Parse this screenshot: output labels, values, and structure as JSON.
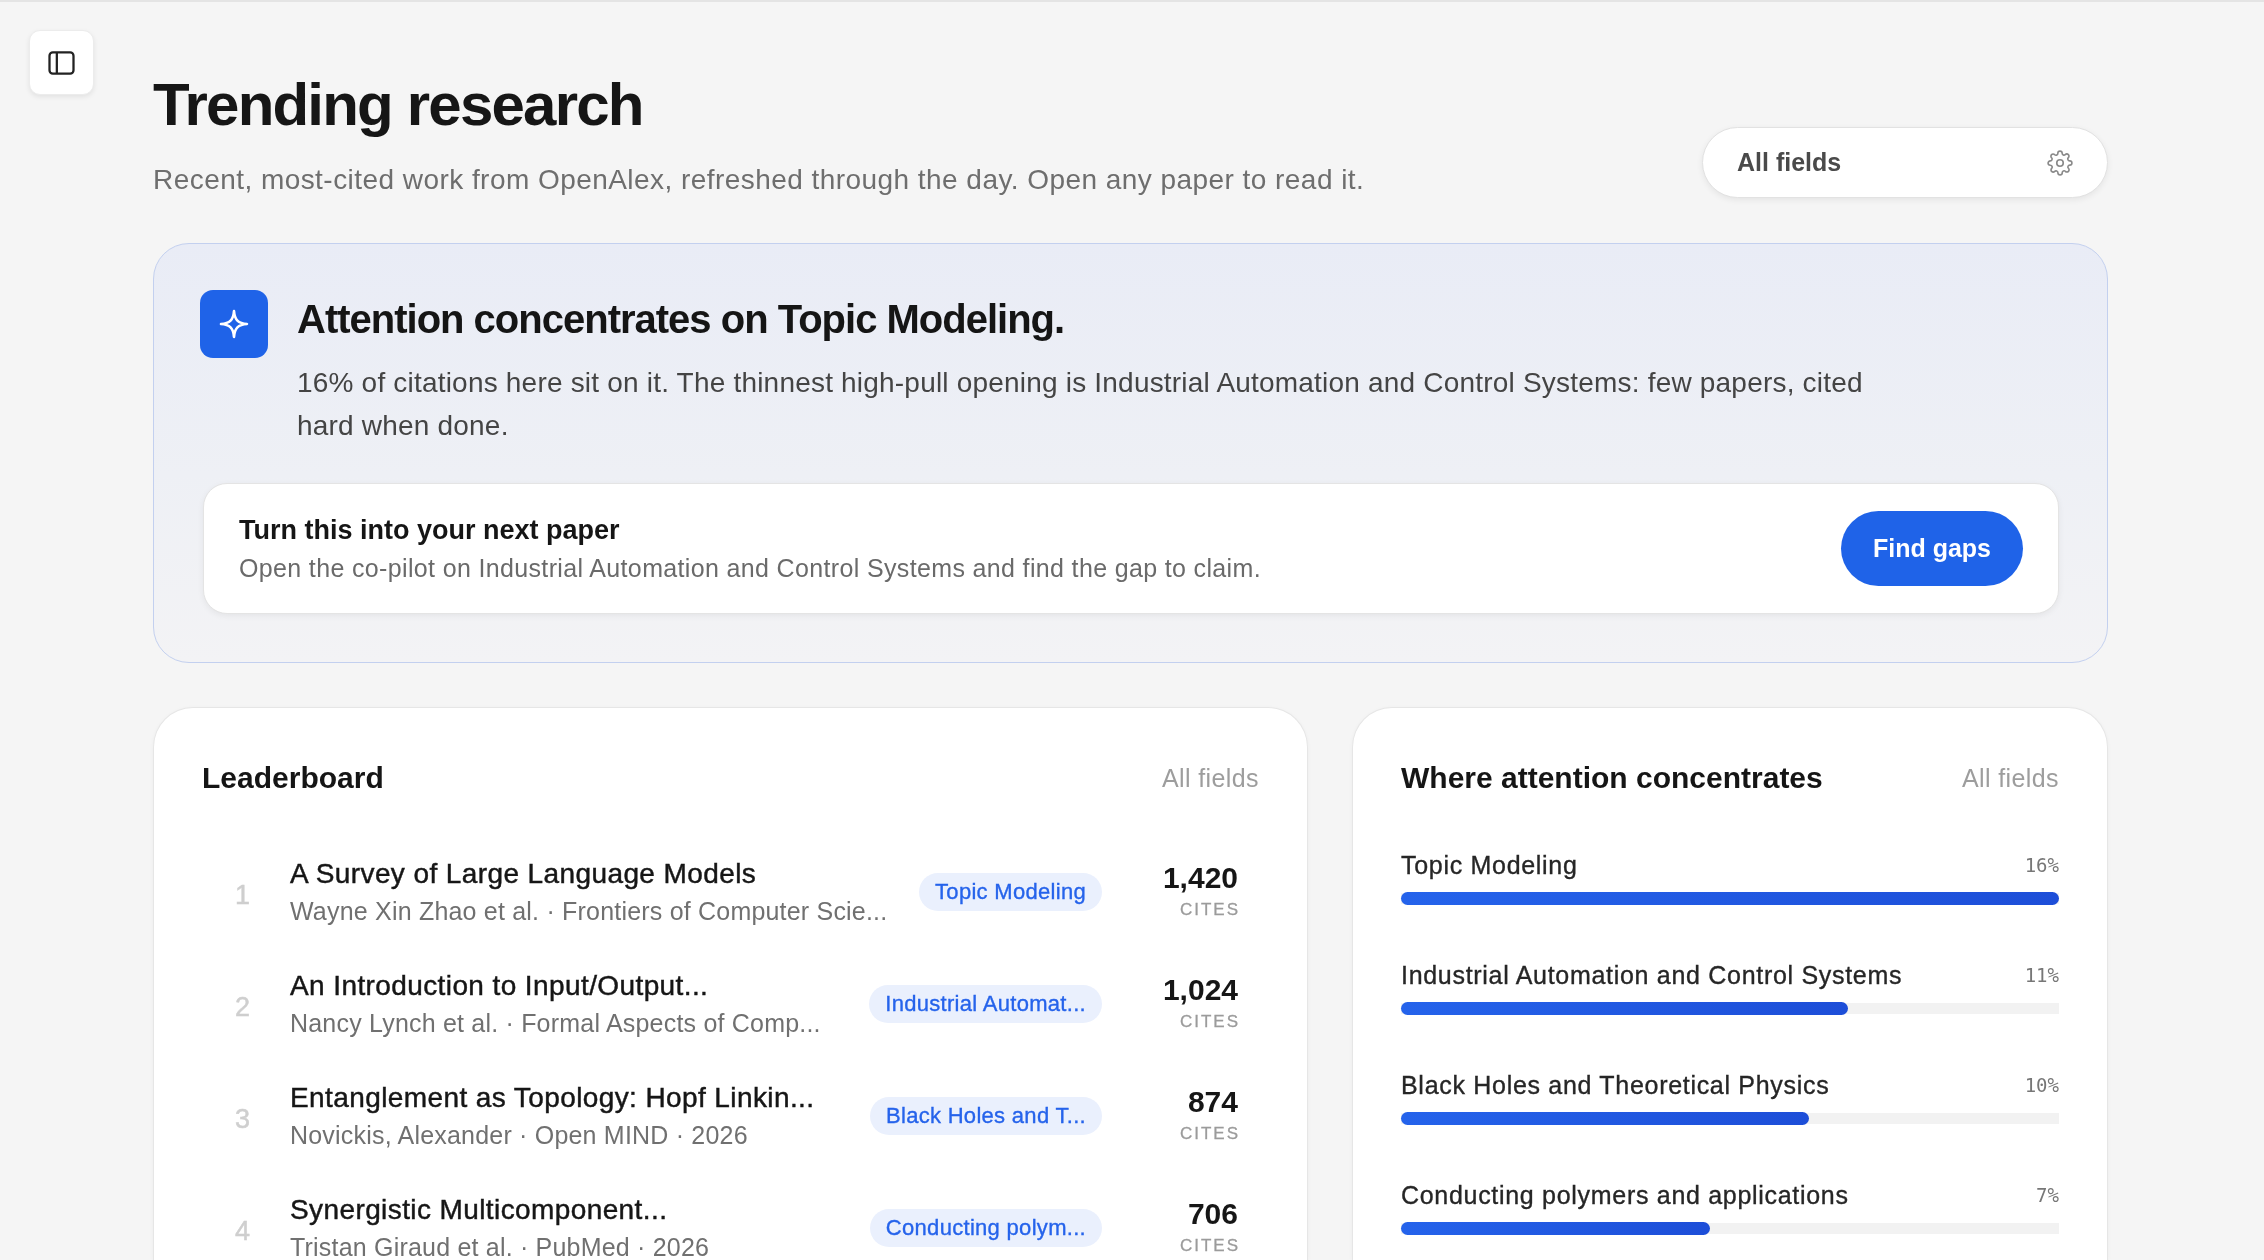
{
  "header": {
    "title": "Trending research",
    "subtitle": "Recent, most-cited work from OpenAlex, refreshed through the day. Open any paper to read it."
  },
  "field_filter": {
    "value": "All fields"
  },
  "insight": {
    "headline": "Attention concentrates on Topic Modeling.",
    "body": "16% of citations here sit on it. The thinnest high-pull opening is Industrial Automation and Control Systems: few papers, cited hard when done.",
    "cta": {
      "title": "Turn this into your next paper",
      "text": "Open the co-pilot on Industrial Automation and Control Systems and find the gap to claim.",
      "button": "Find gaps"
    }
  },
  "leaderboard": {
    "title": "Leaderboard",
    "scope": "All fields",
    "rows": [
      {
        "rank": "1",
        "title": "A Survey of Large Language Models",
        "meta": "Wayne Xin Zhao et al. · Frontiers of Computer Scie...",
        "tag": "Topic Modeling",
        "count": "1,420",
        "count_label": "CITES"
      },
      {
        "rank": "2",
        "title": "An Introduction to Input/Output...",
        "meta": "Nancy Lynch et al. · Formal Aspects of Comp...",
        "tag": "Industrial Automat...",
        "count": "1,024",
        "count_label": "CITES"
      },
      {
        "rank": "3",
        "title": "Entanglement as Topology: Hopf Linkin...",
        "meta": "Novickis, Alexander · Open MIND · 2026",
        "tag": "Black Holes and T...",
        "count": "874",
        "count_label": "CITES"
      },
      {
        "rank": "4",
        "title": "Synergistic Multicomponent...",
        "meta": "Tristan Giraud et al. · PubMed · 2026",
        "tag": "Conducting polym...",
        "count": "706",
        "count_label": "CITES"
      }
    ]
  },
  "concentration": {
    "title": "Where attention concentrates",
    "scope": "All fields",
    "topics": [
      {
        "name": "Topic Modeling",
        "share": "16%",
        "level": 1.0
      },
      {
        "name": "Industrial Automation and Control Systems",
        "share": "11%",
        "level": 0.68
      },
      {
        "name": "Black Holes and Theoretical Physics",
        "share": "10%",
        "level": 0.62
      },
      {
        "name": "Conducting polymers and applications",
        "share": "7%",
        "level": 0.47
      }
    ]
  }
}
